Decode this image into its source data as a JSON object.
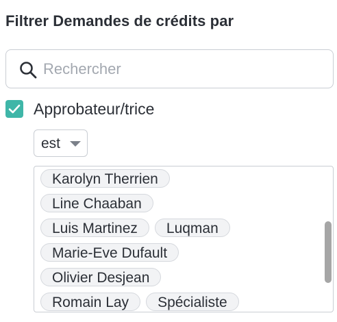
{
  "panel": {
    "title": "Filtrer Demandes de crédits par"
  },
  "search": {
    "placeholder": "Rechercher",
    "value": ""
  },
  "filter": {
    "checked": true,
    "label": "Approbateur/trice",
    "operator": "est"
  },
  "values": {
    "rows": [
      [
        "Karolyn Therrien"
      ],
      [
        "Line Chaaban"
      ],
      [
        "Luis Martinez",
        "Luqman"
      ],
      [
        "Marie-Eve Dufault"
      ],
      [
        "Olivier Desjean"
      ],
      [
        "Romain Lay",
        "Spécialiste"
      ]
    ]
  },
  "colors": {
    "accent": "#3fb6a8",
    "chip_background": "#f2f3f5",
    "border": "#c9cdd3",
    "placeholder": "#a3a8b0"
  },
  "icons": {
    "search": "search-icon",
    "checkbox": "check-icon",
    "select": "caret-down-icon"
  }
}
